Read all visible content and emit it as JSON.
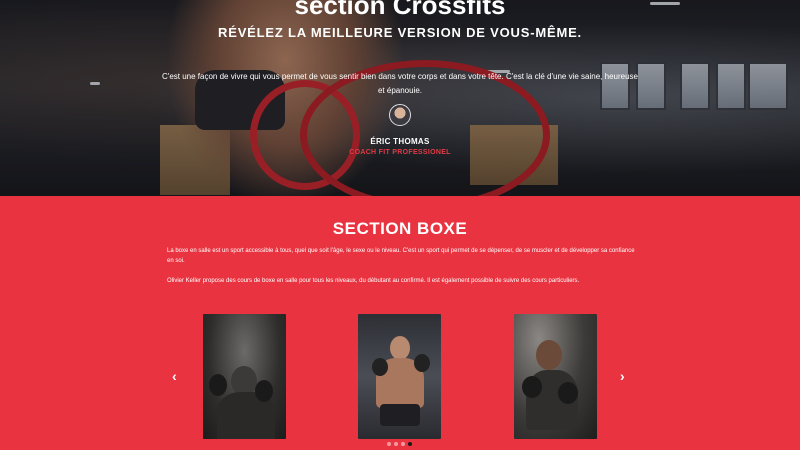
{
  "hero": {
    "title": "section Crossfits",
    "subtitle": "RÉVÉLEZ LA MEILLEURE VERSION DE VOUS-MÊME.",
    "quote": "C'est une façon de vivre qui vous permet de vous sentir bien dans votre corps et dans votre tête. C'est la clé d'une vie saine, heureuse et épanouie.",
    "author": "ÉRIC THOMAS",
    "role": "COACH FIT PROFESSIONEL"
  },
  "boxe": {
    "title": "SECTION BOXE",
    "paragraph1": "La boxe en salle est un sport accessible à tous, quel que soit l'âge, le sexe ou le niveau. C'est un sport qui permet de se dépenser, de se muscler et de développer sa confiance en soi.",
    "paragraph2": "Olivier Keller propose des cours de boxe en salle pour tous les niveaux, du débutant au confirmé. Il est également possible de suivre des cours particuliers.",
    "carousel": {
      "prev_icon": "‹",
      "next_icon": "›",
      "dots": [
        false,
        false,
        false,
        true
      ]
    }
  },
  "colors": {
    "accent": "#ea3340",
    "role_text": "#e23a44"
  }
}
